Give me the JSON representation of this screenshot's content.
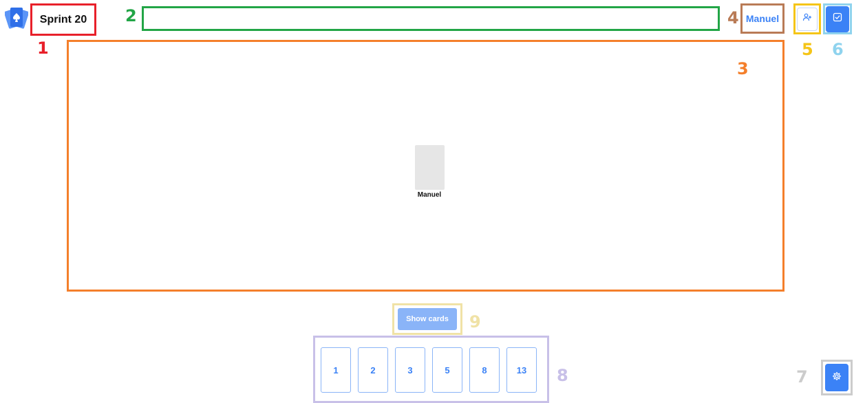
{
  "header": {
    "room_title": "Sprint 20",
    "title_input_value": "",
    "player_name": "Manuel"
  },
  "table": {
    "players": [
      {
        "name": "Manuel"
      }
    ]
  },
  "actions": {
    "show_cards_label": "Show cards"
  },
  "deck": {
    "cards": [
      "1",
      "2",
      "3",
      "5",
      "8",
      "13"
    ]
  },
  "annotations": {
    "n1": "1",
    "n2": "2",
    "n3": "3",
    "n4": "4",
    "n5": "5",
    "n6": "6",
    "n7": "7",
    "n8": "8",
    "n9": "9"
  },
  "icons": {
    "logo": "cards-logo-icon",
    "invite": "add-user-icon",
    "tasks": "checkbox-icon",
    "settings": "gear-icon"
  },
  "colors": {
    "accent": "#3b82f6",
    "accent_light": "#8ab4f8",
    "annotation_red": "#e8202a",
    "annotation_green": "#22a546",
    "annotation_orange": "#f47f2b",
    "annotation_brown": "#b97b56",
    "annotation_yellow": "#f5c518",
    "annotation_lightblue": "#8fd3ee",
    "annotation_gray": "#cccccc",
    "annotation_lavender": "#c8c0e8",
    "annotation_beige": "#f0e2a6"
  }
}
